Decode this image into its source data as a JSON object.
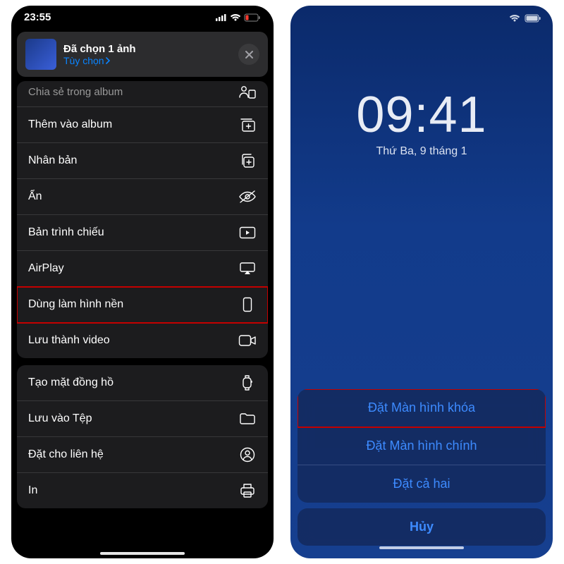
{
  "left": {
    "status_time": "23:55",
    "header_title": "Đã chọn 1 ảnh",
    "header_options": "Tùy chọn",
    "groups": [
      {
        "cutTop": true,
        "rows": [
          {
            "label": "Chia sẻ trong album",
            "icon": "person-add"
          },
          {
            "label": "Thêm vào album",
            "icon": "album-add"
          },
          {
            "label": "Nhân bản",
            "icon": "duplicate"
          },
          {
            "label": "Ẩn",
            "icon": "eye-off"
          },
          {
            "label": "Bản trình chiếu",
            "icon": "play-rect"
          },
          {
            "label": "AirPlay",
            "icon": "airplay"
          },
          {
            "label": "Dùng làm hình nền",
            "icon": "phone-rect",
            "highlight": true
          },
          {
            "label": "Lưu thành video",
            "icon": "video"
          }
        ]
      },
      {
        "rows": [
          {
            "label": "Tạo mặt đồng hồ",
            "icon": "watch"
          },
          {
            "label": "Lưu vào Tệp",
            "icon": "folder"
          },
          {
            "label": "Đặt cho liên hệ",
            "icon": "contact"
          },
          {
            "label": "In",
            "icon": "print"
          }
        ]
      }
    ]
  },
  "right": {
    "time": "09:41",
    "date": "Thứ Ba, 9 tháng 1",
    "options": [
      {
        "label": "Đặt Màn hình khóa",
        "highlight": true
      },
      {
        "label": "Đặt Màn hình chính"
      },
      {
        "label": "Đặt cả hai"
      }
    ],
    "cancel": "Hủy"
  }
}
